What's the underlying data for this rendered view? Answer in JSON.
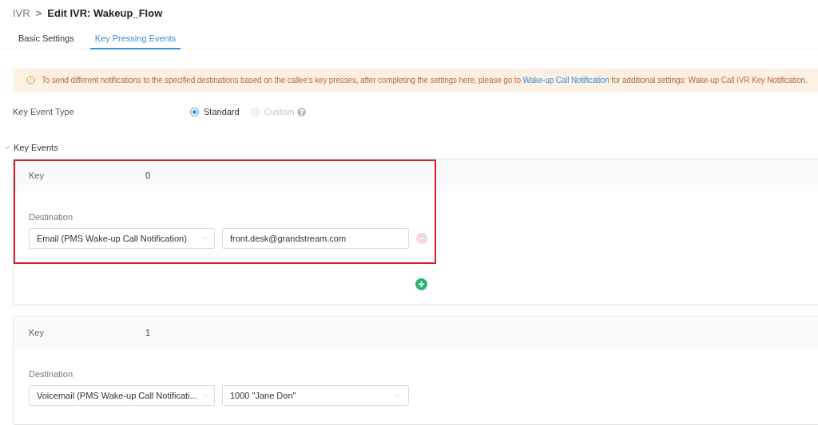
{
  "breadcrumb": {
    "parent": "IVR",
    "separator": ">",
    "current": "Edit IVR: Wakeup_Flow"
  },
  "tabs": [
    {
      "label": "Basic Settings",
      "selected": false
    },
    {
      "label": "Key Pressing Events",
      "selected": true
    }
  ],
  "notice": {
    "text_before": "To send different notifications to the specified destinations based on the callee's key presses, after completing the settings here, please go to",
    "link": "Wake-up Call Notification",
    "text_after": "for additional settings: Wake-up Call IVR Key Notification."
  },
  "key_event_type": {
    "label": "Key Event Type",
    "options": [
      {
        "label": "Standard",
        "selected": true,
        "disabled": false,
        "help": false
      },
      {
        "label": "Custom",
        "selected": false,
        "disabled": true,
        "help": true
      }
    ]
  },
  "key_events": {
    "title": "Key Events",
    "expanded": true,
    "events": [
      {
        "key_label": "Key",
        "key": "0",
        "destination_label": "Destination",
        "highlighted": true,
        "destination_type": "Email (PMS Wake-up Call Notification)",
        "destination_value": {
          "kind": "input",
          "value": "front.desk@grandstream.com"
        },
        "remove_button": {
          "disabled": true
        },
        "add_button": true
      },
      {
        "key_label": "Key",
        "key": "1",
        "destination_label": "Destination",
        "highlighted": false,
        "destination_type": "Voicemail (PMS Wake-up Call Notificati...",
        "destination_value": {
          "kind": "select",
          "value": "1000 \"Jane Don\""
        },
        "add_button": false
      }
    ]
  }
}
